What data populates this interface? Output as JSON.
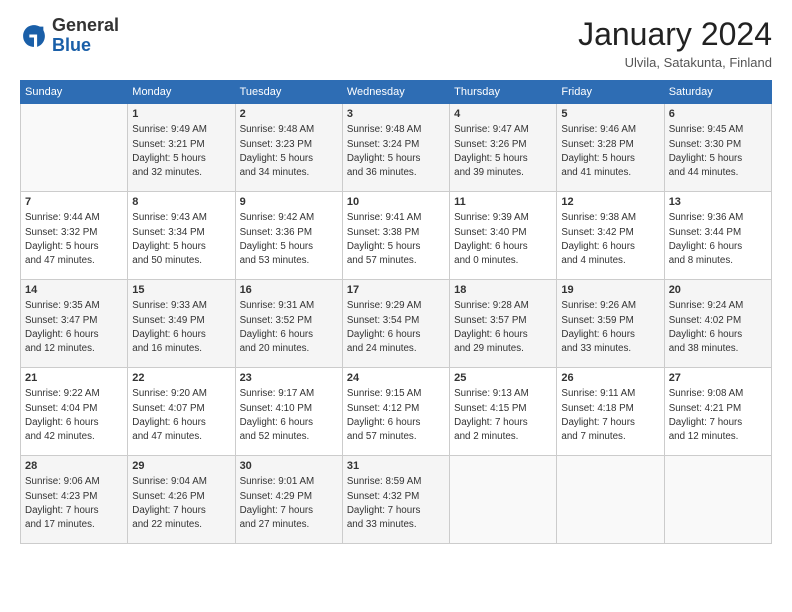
{
  "logo": {
    "general": "General",
    "blue": "Blue"
  },
  "header": {
    "title": "January 2024",
    "subtitle": "Ulvila, Satakunta, Finland"
  },
  "columns": [
    "Sunday",
    "Monday",
    "Tuesday",
    "Wednesday",
    "Thursday",
    "Friday",
    "Saturday"
  ],
  "weeks": [
    [
      {
        "day": "",
        "info": ""
      },
      {
        "day": "1",
        "info": "Sunrise: 9:49 AM\nSunset: 3:21 PM\nDaylight: 5 hours\nand 32 minutes."
      },
      {
        "day": "2",
        "info": "Sunrise: 9:48 AM\nSunset: 3:23 PM\nDaylight: 5 hours\nand 34 minutes."
      },
      {
        "day": "3",
        "info": "Sunrise: 9:48 AM\nSunset: 3:24 PM\nDaylight: 5 hours\nand 36 minutes."
      },
      {
        "day": "4",
        "info": "Sunrise: 9:47 AM\nSunset: 3:26 PM\nDaylight: 5 hours\nand 39 minutes."
      },
      {
        "day": "5",
        "info": "Sunrise: 9:46 AM\nSunset: 3:28 PM\nDaylight: 5 hours\nand 41 minutes."
      },
      {
        "day": "6",
        "info": "Sunrise: 9:45 AM\nSunset: 3:30 PM\nDaylight: 5 hours\nand 44 minutes."
      }
    ],
    [
      {
        "day": "7",
        "info": "Sunrise: 9:44 AM\nSunset: 3:32 PM\nDaylight: 5 hours\nand 47 minutes."
      },
      {
        "day": "8",
        "info": "Sunrise: 9:43 AM\nSunset: 3:34 PM\nDaylight: 5 hours\nand 50 minutes."
      },
      {
        "day": "9",
        "info": "Sunrise: 9:42 AM\nSunset: 3:36 PM\nDaylight: 5 hours\nand 53 minutes."
      },
      {
        "day": "10",
        "info": "Sunrise: 9:41 AM\nSunset: 3:38 PM\nDaylight: 5 hours\nand 57 minutes."
      },
      {
        "day": "11",
        "info": "Sunrise: 9:39 AM\nSunset: 3:40 PM\nDaylight: 6 hours\nand 0 minutes."
      },
      {
        "day": "12",
        "info": "Sunrise: 9:38 AM\nSunset: 3:42 PM\nDaylight: 6 hours\nand 4 minutes."
      },
      {
        "day": "13",
        "info": "Sunrise: 9:36 AM\nSunset: 3:44 PM\nDaylight: 6 hours\nand 8 minutes."
      }
    ],
    [
      {
        "day": "14",
        "info": "Sunrise: 9:35 AM\nSunset: 3:47 PM\nDaylight: 6 hours\nand 12 minutes."
      },
      {
        "day": "15",
        "info": "Sunrise: 9:33 AM\nSunset: 3:49 PM\nDaylight: 6 hours\nand 16 minutes."
      },
      {
        "day": "16",
        "info": "Sunrise: 9:31 AM\nSunset: 3:52 PM\nDaylight: 6 hours\nand 20 minutes."
      },
      {
        "day": "17",
        "info": "Sunrise: 9:29 AM\nSunset: 3:54 PM\nDaylight: 6 hours\nand 24 minutes."
      },
      {
        "day": "18",
        "info": "Sunrise: 9:28 AM\nSunset: 3:57 PM\nDaylight: 6 hours\nand 29 minutes."
      },
      {
        "day": "19",
        "info": "Sunrise: 9:26 AM\nSunset: 3:59 PM\nDaylight: 6 hours\nand 33 minutes."
      },
      {
        "day": "20",
        "info": "Sunrise: 9:24 AM\nSunset: 4:02 PM\nDaylight: 6 hours\nand 38 minutes."
      }
    ],
    [
      {
        "day": "21",
        "info": "Sunrise: 9:22 AM\nSunset: 4:04 PM\nDaylight: 6 hours\nand 42 minutes."
      },
      {
        "day": "22",
        "info": "Sunrise: 9:20 AM\nSunset: 4:07 PM\nDaylight: 6 hours\nand 47 minutes."
      },
      {
        "day": "23",
        "info": "Sunrise: 9:17 AM\nSunset: 4:10 PM\nDaylight: 6 hours\nand 52 minutes."
      },
      {
        "day": "24",
        "info": "Sunrise: 9:15 AM\nSunset: 4:12 PM\nDaylight: 6 hours\nand 57 minutes."
      },
      {
        "day": "25",
        "info": "Sunrise: 9:13 AM\nSunset: 4:15 PM\nDaylight: 7 hours\nand 2 minutes."
      },
      {
        "day": "26",
        "info": "Sunrise: 9:11 AM\nSunset: 4:18 PM\nDaylight: 7 hours\nand 7 minutes."
      },
      {
        "day": "27",
        "info": "Sunrise: 9:08 AM\nSunset: 4:21 PM\nDaylight: 7 hours\nand 12 minutes."
      }
    ],
    [
      {
        "day": "28",
        "info": "Sunrise: 9:06 AM\nSunset: 4:23 PM\nDaylight: 7 hours\nand 17 minutes."
      },
      {
        "day": "29",
        "info": "Sunrise: 9:04 AM\nSunset: 4:26 PM\nDaylight: 7 hours\nand 22 minutes."
      },
      {
        "day": "30",
        "info": "Sunrise: 9:01 AM\nSunset: 4:29 PM\nDaylight: 7 hours\nand 27 minutes."
      },
      {
        "day": "31",
        "info": "Sunrise: 8:59 AM\nSunset: 4:32 PM\nDaylight: 7 hours\nand 33 minutes."
      },
      {
        "day": "",
        "info": ""
      },
      {
        "day": "",
        "info": ""
      },
      {
        "day": "",
        "info": ""
      }
    ]
  ]
}
